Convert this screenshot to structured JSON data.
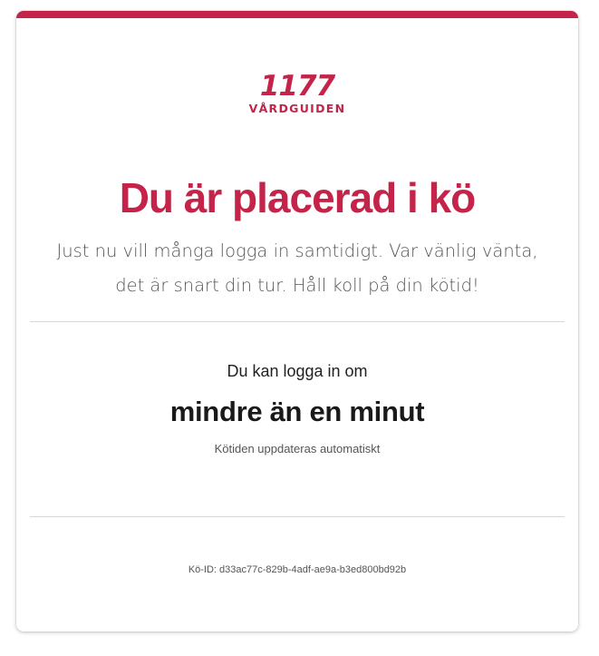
{
  "brand": {
    "logo_number": "1177",
    "logo_text": "VÅRDGUIDEN"
  },
  "colors": {
    "accent": "#c4244a"
  },
  "queue": {
    "title": "Du är placerad i kö",
    "subtitle_line1": "Just nu vill många logga in samtidigt. Var vänlig vänta,",
    "subtitle_line2": "det är snart din tur. Håll koll på din kötid!",
    "wait_label": "Du kan logga in om",
    "wait_time": "mindre än en minut",
    "wait_note": "Kötiden uppdateras automatiskt",
    "queue_id": "Kö-ID: d33ac77c-829b-4adf-ae9a-b3ed800bd92b"
  }
}
